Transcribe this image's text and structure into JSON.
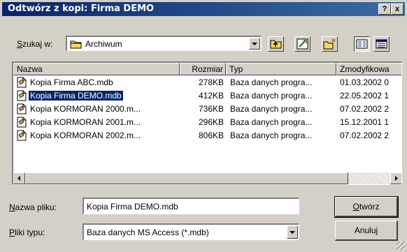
{
  "window": {
    "title": "Odtwórz z kopi: Firma DEMO",
    "help_label": "?",
    "close_label": "x"
  },
  "lookin": {
    "label_u": "S",
    "label_rest": "zukaj w:",
    "value": "Archiwum"
  },
  "list": {
    "columns": [
      "Nazwa",
      "Rozmiar",
      "Typ",
      "Zmodyfikowa"
    ],
    "rows": [
      {
        "name": "Kopia Firma ABC.mdb",
        "size": "278KB",
        "type": "Baza danych progra...",
        "modified": "01.03.2002 0",
        "selected": false
      },
      {
        "name": "Kopia Firma DEMO.mdb",
        "size": "412KB",
        "type": "Baza danych progra...",
        "modified": "22.05.2002 1",
        "selected": true
      },
      {
        "name": "Kopia KORMORAN 2000.m...",
        "size": "736KB",
        "type": "Baza danych progra...",
        "modified": "07.02.2002 2",
        "selected": false
      },
      {
        "name": "Kopia KORMORAN 2001.m...",
        "size": "296KB",
        "type": "Baza danych progra...",
        "modified": "15.12.2001 1",
        "selected": false
      },
      {
        "name": "Kopia KORMORAN 2002.m...",
        "size": "806KB",
        "type": "Baza danych progra...",
        "modified": "07.02.2002 2",
        "selected": false
      }
    ]
  },
  "filename": {
    "label_u": "N",
    "label_rest": "azwa pliku:",
    "value": "Kopia Firma DEMO.mdb"
  },
  "filetype": {
    "label_u": "P",
    "label_rest": "liki typu:",
    "value": "Baza danych MS Access (*.mdb)"
  },
  "buttons": {
    "open_u": "O",
    "open_rest": "twórz",
    "cancel": "Anuluj"
  },
  "colors": {
    "titlebar": "#0a246a",
    "selection": "#0a246a",
    "face": "#d4d0c8"
  }
}
